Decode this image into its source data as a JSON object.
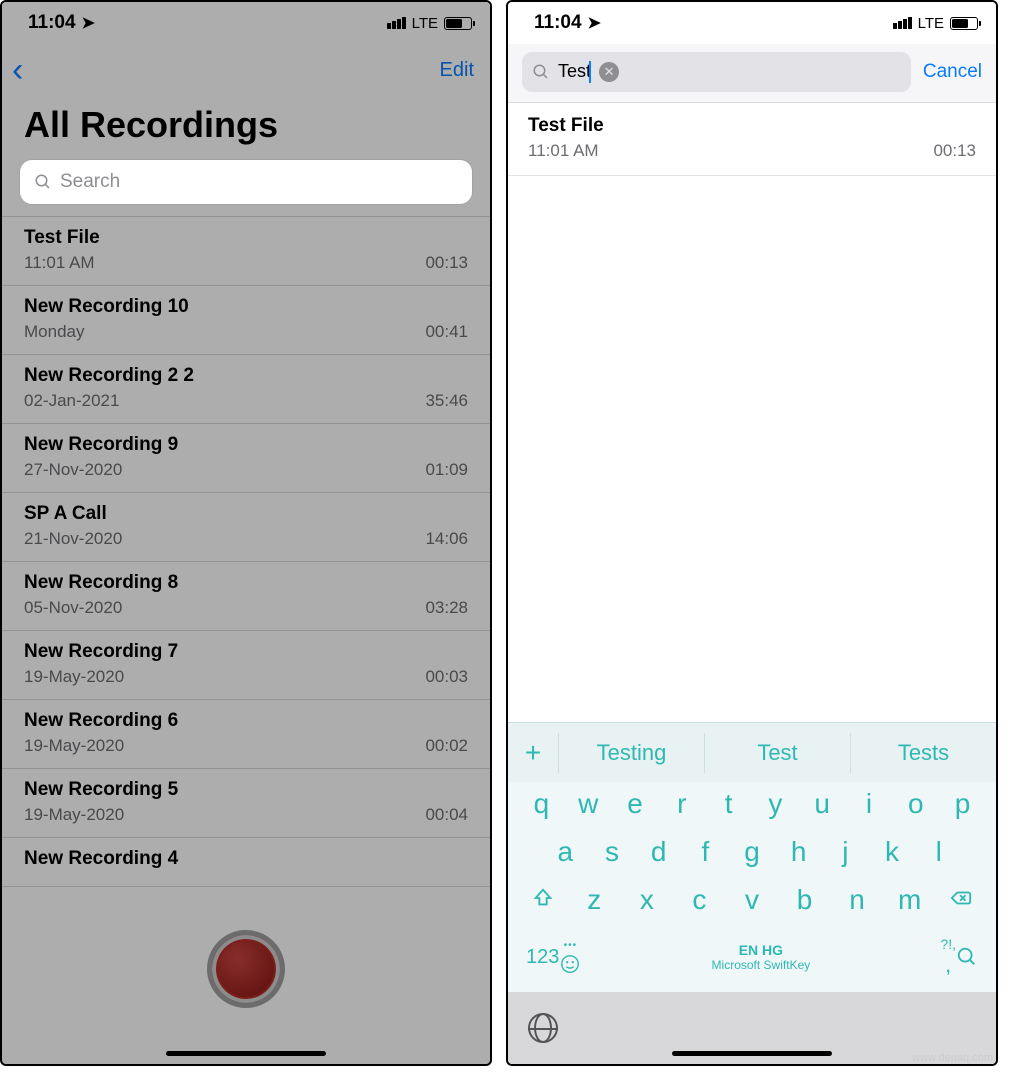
{
  "status": {
    "time": "11:04",
    "network": "LTE"
  },
  "left": {
    "edit_label": "Edit",
    "title": "All Recordings",
    "search_placeholder": "Search",
    "recordings": [
      {
        "title": "Test File",
        "subtitle": "11:01 AM",
        "duration": "00:13"
      },
      {
        "title": "New Recording 10",
        "subtitle": "Monday",
        "duration": "00:41"
      },
      {
        "title": "New Recording 2 2",
        "subtitle": "02-Jan-2021",
        "duration": "35:46"
      },
      {
        "title": "New Recording 9",
        "subtitle": "27-Nov-2020",
        "duration": "01:09"
      },
      {
        "title": "SP A Call",
        "subtitle": "21-Nov-2020",
        "duration": "14:06"
      },
      {
        "title": "New Recording 8",
        "subtitle": "05-Nov-2020",
        "duration": "03:28"
      },
      {
        "title": "New Recording 7",
        "subtitle": "19-May-2020",
        "duration": "00:03"
      },
      {
        "title": "New Recording 6",
        "subtitle": "19-May-2020",
        "duration": "00:02"
      },
      {
        "title": "New Recording 5",
        "subtitle": "19-May-2020",
        "duration": "00:04"
      },
      {
        "title": "New Recording 4",
        "subtitle": "",
        "duration": ""
      }
    ]
  },
  "right": {
    "search_query": "Test",
    "cancel_label": "Cancel",
    "results": [
      {
        "title": "Test File",
        "subtitle": "11:01 AM",
        "duration": "00:13"
      }
    ],
    "keyboard": {
      "suggestions": [
        "Testing",
        "Test",
        "Tests"
      ],
      "row1": [
        "q",
        "w",
        "e",
        "r",
        "t",
        "y",
        "u",
        "i",
        "o",
        "p"
      ],
      "row2": [
        "a",
        "s",
        "d",
        "f",
        "g",
        "h",
        "j",
        "k",
        "l"
      ],
      "row3": [
        "z",
        "x",
        "c",
        "v",
        "b",
        "n",
        "m"
      ],
      "numbers_label": "123",
      "lang_label": "EN HG",
      "brand_label": "Microsoft SwiftKey",
      "punct_label": "?!,",
      "comma_label": ","
    }
  },
  "watermark": "www.deuaq.com"
}
